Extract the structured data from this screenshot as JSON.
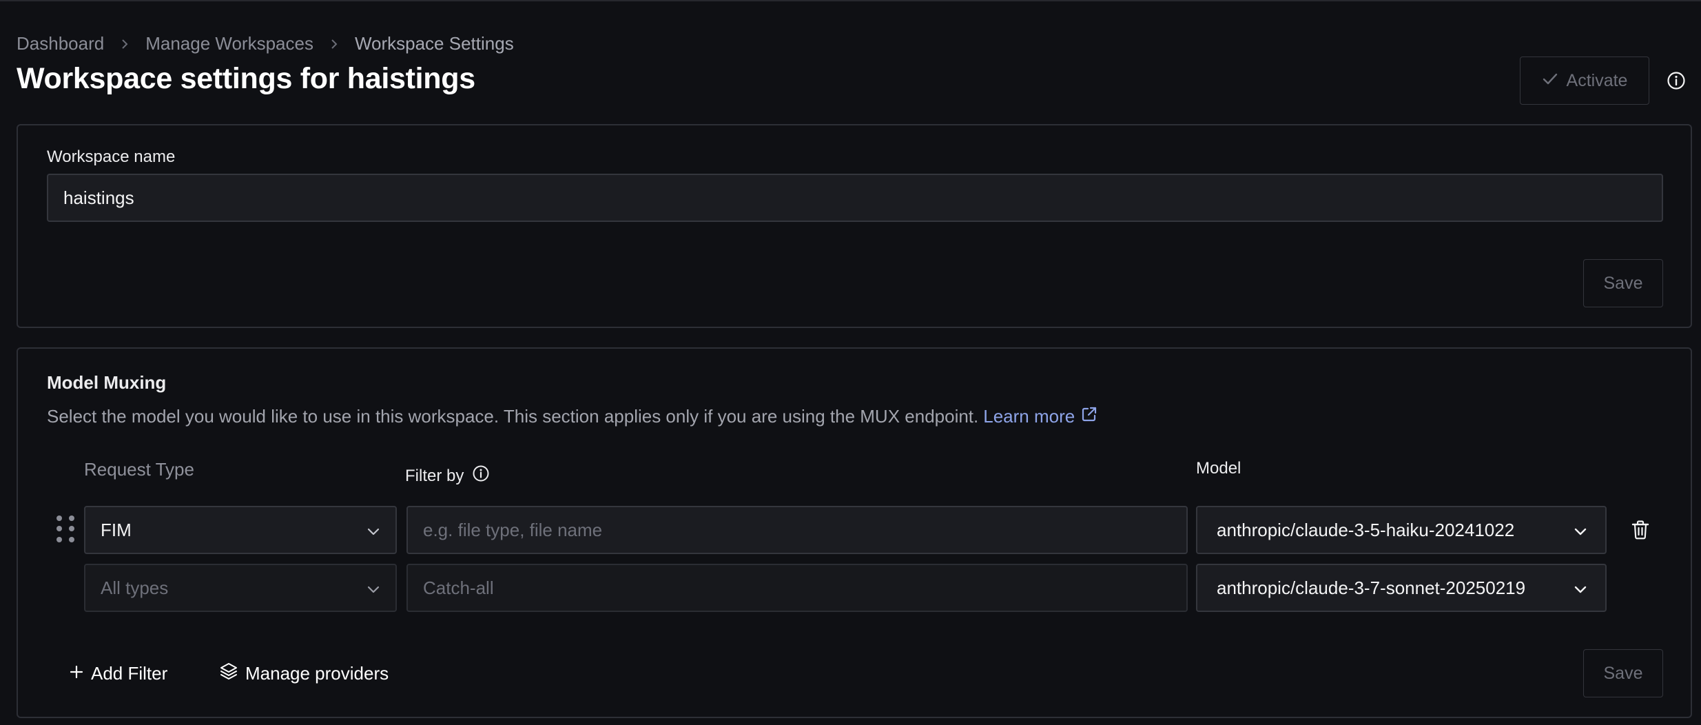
{
  "breadcrumb": {
    "items": [
      "Dashboard",
      "Manage Workspaces",
      "Workspace Settings"
    ]
  },
  "header": {
    "title": "Workspace settings for haistings",
    "activate_label": "Activate"
  },
  "workspace_name_card": {
    "label": "Workspace name",
    "value": "haistings",
    "save_label": "Save"
  },
  "model_muxing": {
    "title": "Model Muxing",
    "description": "Select the model you would like to use in this workspace. This section applies only if you are using the MUX endpoint.",
    "learn_more_label": "Learn more",
    "columns": {
      "request_type": "Request Type",
      "filter_by": "Filter by",
      "model": "Model"
    },
    "rows": [
      {
        "request_type": "FIM",
        "filter_placeholder": "e.g. file type, file name",
        "model": "anthropic/claude-3-5-haiku-20241022"
      },
      {
        "request_type": "All types",
        "filter_placeholder": "Catch-all",
        "model": "anthropic/claude-3-7-sonnet-20250219"
      }
    ],
    "add_filter_label": "Add Filter",
    "manage_providers_label": "Manage providers",
    "save_label": "Save"
  },
  "colors": {
    "background": "#0f1014",
    "card_border": "#2d2f36",
    "input_bg": "#1b1c21",
    "link": "#8ea4e8",
    "muted_text": "#6e707a"
  }
}
